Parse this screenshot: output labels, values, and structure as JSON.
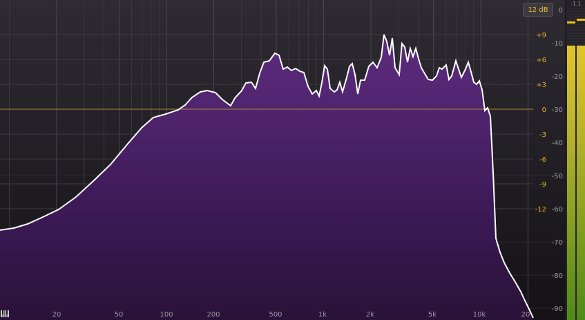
{
  "range_button": {
    "label": "12 dB"
  },
  "meter": {
    "top_label": "0",
    "peak_readout": "-1.1"
  },
  "freq_labels": [
    "20",
    "50",
    "100",
    "200",
    "500",
    "1k",
    "2k",
    "5k",
    "10k",
    "20"
  ],
  "gain_labels": [
    "+9",
    "+6",
    "+3",
    "0",
    "-3",
    "-6",
    "-9",
    "-12"
  ],
  "db_labels": [
    "-10",
    "-20",
    "-30",
    "-40",
    "-50",
    "-60",
    "-70",
    "-80",
    "-90"
  ],
  "colors": {
    "background": "#1b191d",
    "fill_top": "#5a2a78",
    "fill_bottom": "#2a1238",
    "curve": "#ffffff",
    "zero_line": "#b08a3a",
    "gain_text": "#e8b22b",
    "meter_green": "#6a9a20",
    "meter_yellow": "#d8c02a"
  }
}
